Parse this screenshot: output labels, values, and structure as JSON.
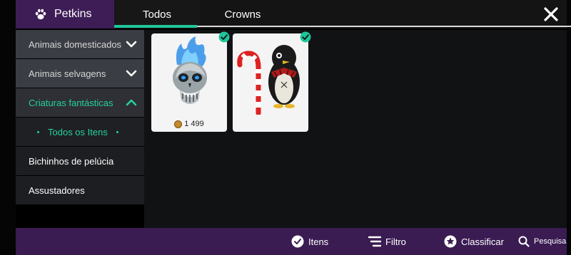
{
  "header": {
    "brand": "Petkins",
    "tabs": [
      {
        "label": "Todos",
        "active": true
      },
      {
        "label": "Crowns",
        "active": false
      }
    ],
    "close_icon": "close-icon"
  },
  "sidebar": {
    "items": [
      {
        "label": "Animais domesticados",
        "state": "collapsed"
      },
      {
        "label": "Animais selvagens",
        "state": "collapsed"
      },
      {
        "label": "Criaturas fantásticas",
        "state": "expanded"
      },
      {
        "label": "Todos os Itens",
        "state": "selected-sub"
      },
      {
        "label": "Bichinhos de pelúcia",
        "state": "plain"
      },
      {
        "label": "Assustadores",
        "state": "plain"
      }
    ]
  },
  "items": [
    {
      "art": "flaming-skull",
      "price": "1 499",
      "owned": true
    },
    {
      "art": "penguin-with-candy-cane",
      "price": "",
      "owned": true
    }
  ],
  "footer": {
    "itens": "Itens",
    "filtro": "Filtro",
    "classificar": "Classificar",
    "pesquisa": "Pesquisa"
  },
  "colors": {
    "accent": "#1fc69a",
    "brand_purple": "#3e1d56",
    "footer_purple": "#3a1b52"
  }
}
